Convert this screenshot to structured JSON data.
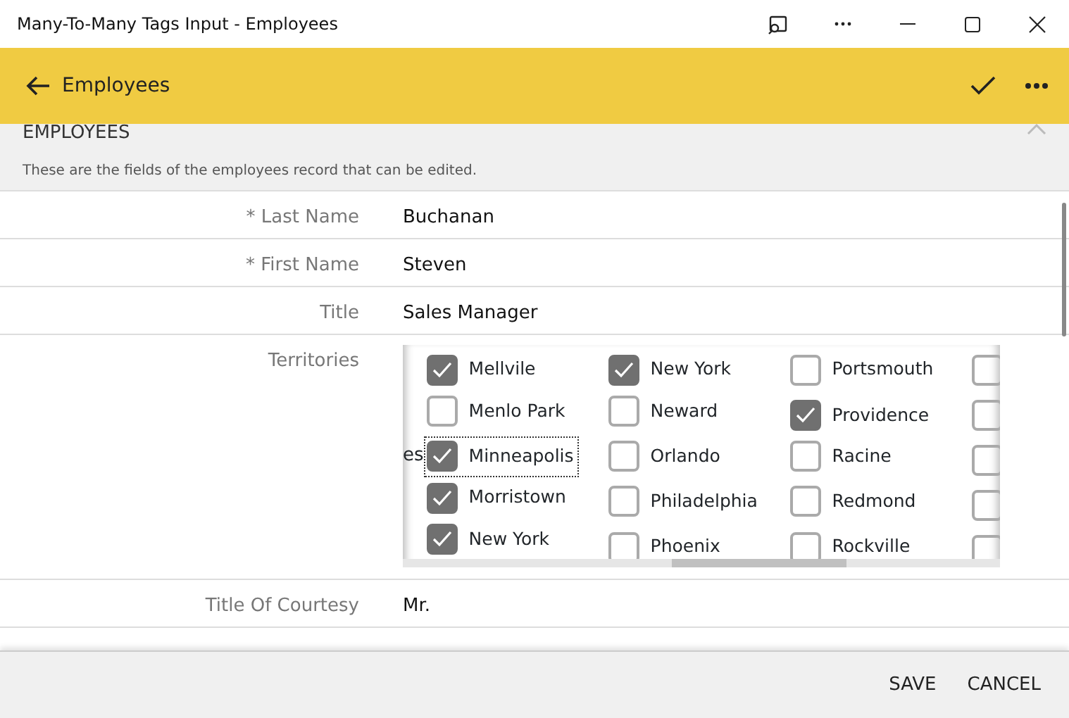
{
  "window": {
    "title": "Many-To-Many Tags Input - Employees"
  },
  "header": {
    "title": "Employees"
  },
  "section": {
    "title": "EMPLOYEES",
    "description": "These are the fields of the employees record that can be edited.",
    "expanded": true
  },
  "fields": [
    {
      "kind": "text",
      "label": "* Last Name",
      "value": "Buchanan"
    },
    {
      "kind": "text",
      "label": "* First Name",
      "value": "Steven"
    },
    {
      "kind": "text",
      "label": "Title",
      "value": "Sales Manager"
    },
    {
      "kind": "checklist",
      "label": "Territories",
      "fragment": "es",
      "columns": [
        [
          {
            "label": "Mellvile",
            "checked": true,
            "focused": false
          },
          {
            "label": "Menlo Park",
            "checked": false,
            "focused": false
          },
          {
            "label": "Minneapolis",
            "checked": true,
            "focused": true
          },
          {
            "label": "Morristown",
            "checked": true,
            "focused": false
          },
          {
            "label": "New York",
            "checked": true,
            "focused": false
          }
        ],
        [
          {
            "label": "New York",
            "checked": true,
            "focused": false
          },
          {
            "label": "Neward",
            "checked": false,
            "focused": false
          },
          {
            "label": "Orlando",
            "checked": false,
            "focused": false
          },
          {
            "label": "Philadelphia",
            "checked": false,
            "focused": false
          },
          {
            "label": "Phoenix",
            "checked": false,
            "focused": false
          }
        ],
        [
          {
            "label": "Portsmouth",
            "checked": false,
            "focused": false
          },
          {
            "label": "Providence",
            "checked": true,
            "focused": false
          },
          {
            "label": "Racine",
            "checked": false,
            "focused": false
          },
          {
            "label": "Redmond",
            "checked": false,
            "focused": false
          },
          {
            "label": "Rockville",
            "checked": false,
            "focused": false
          }
        ],
        [
          {
            "checked": false,
            "focused": false
          },
          {
            "checked": false,
            "focused": false
          },
          {
            "checked": false,
            "focused": false
          },
          {
            "checked": false,
            "focused": false
          },
          {
            "checked": false,
            "focused": false
          }
        ]
      ]
    },
    {
      "kind": "text",
      "label": "Title Of Courtesy",
      "value": "Mr."
    }
  ],
  "footer": {
    "buttons": [
      "SAVE",
      "CANCEL"
    ]
  }
}
